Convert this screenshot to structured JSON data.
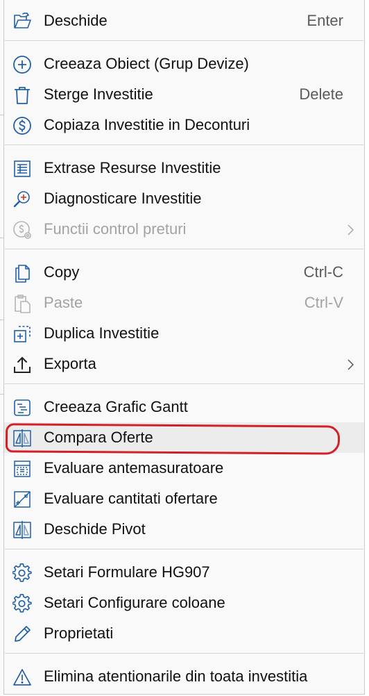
{
  "menu": {
    "open": {
      "label": "Deschide",
      "shortcut": "Enter",
      "icon": "open-folder-icon"
    },
    "create_object": {
      "label": "Creeaza Obiect (Grup Devize)",
      "icon": "plus-circle-icon"
    },
    "delete_investment": {
      "label": "Sterge Investitie",
      "shortcut": "Delete",
      "icon": "trash-icon"
    },
    "copy_to_settlements": {
      "label": "Copiaza Investitie in Deconturi",
      "icon": "dollar-circle-icon"
    },
    "extract_resources": {
      "label": "Extrase Resurse Investitie",
      "icon": "table-icon"
    },
    "diagnose": {
      "label": "Diagnosticare Investitie",
      "icon": "diagnose-magnifier-icon"
    },
    "price_control": {
      "label": "Functii control preturi",
      "icon": "price-settings-icon",
      "disabled": true
    },
    "copy": {
      "label": "Copy",
      "shortcut": "Ctrl-C",
      "icon": "copy-icon"
    },
    "paste": {
      "label": "Paste",
      "shortcut": "Ctrl-V",
      "icon": "paste-icon",
      "disabled": true
    },
    "duplicate": {
      "label": "Duplica Investitie",
      "icon": "duplicate-icon"
    },
    "export": {
      "label": "Exporta",
      "icon": "upload-icon"
    },
    "gantt": {
      "label": "Creeaza Grafic Gantt",
      "icon": "gantt-icon"
    },
    "compare_offers": {
      "label": "Compara Oferte",
      "icon": "compare-icon",
      "highlighted": true
    },
    "evaluate_estimates": {
      "label": "Evaluare antemasuratoare",
      "icon": "evaluate-estimates-icon"
    },
    "evaluate_quantities": {
      "label": "Evaluare cantitati ofertare",
      "icon": "evaluate-quantities-icon"
    },
    "pivot": {
      "label": "Deschide Pivot",
      "icon": "pivot-icon"
    },
    "hg907_settings": {
      "label": "Setari Formulare HG907",
      "icon": "gear-icon"
    },
    "column_settings": {
      "label": "Setari Configurare coloane",
      "icon": "gear-icon"
    },
    "properties": {
      "label": "Proprietati",
      "icon": "pencil-icon"
    },
    "remove_warnings": {
      "label": "Elimina atentionarile din toata investitia",
      "icon": "warning-icon"
    }
  },
  "colors": {
    "icon_blue": "#1f5fa8",
    "annotation_red": "#d2202a",
    "disabled": "#a3a3a3"
  }
}
